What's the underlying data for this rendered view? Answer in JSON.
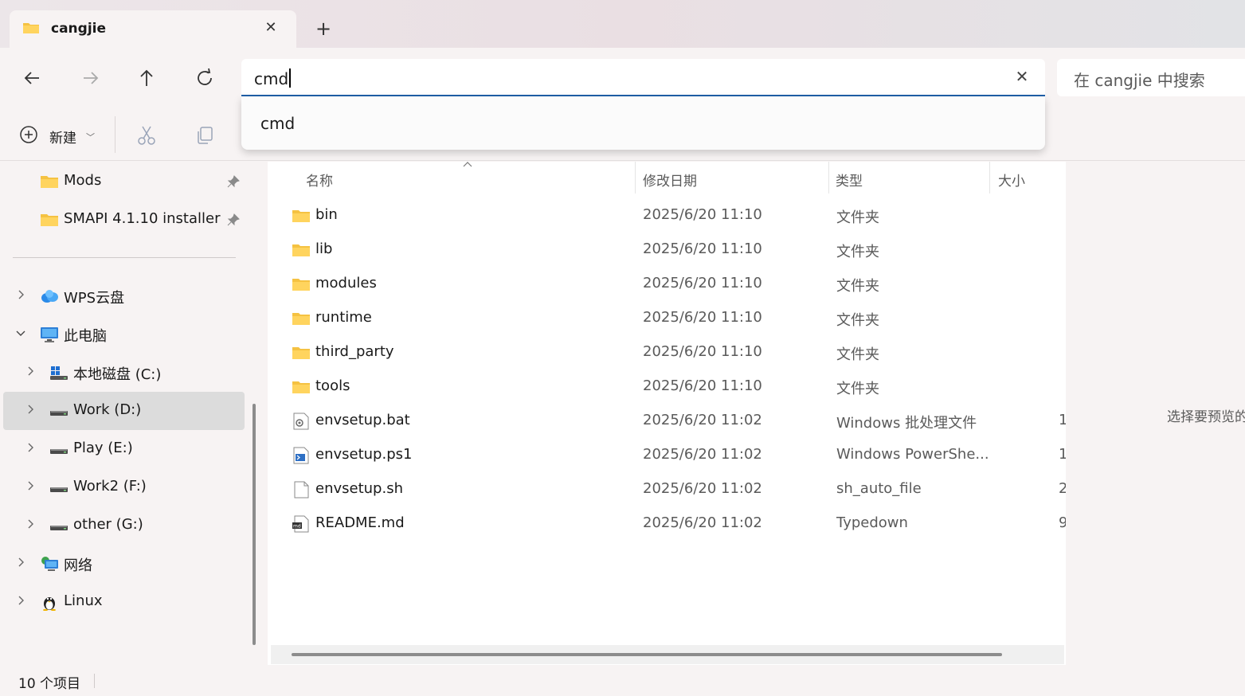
{
  "tab": {
    "title": "cangjie",
    "close_icon": "close-icon",
    "new_tab_icon": "plus-icon"
  },
  "nav": {
    "back_icon": "arrow-left-icon",
    "forward_icon": "arrow-right-icon",
    "up_icon": "arrow-up-icon",
    "refresh_icon": "refresh-icon",
    "address_value": "cmd",
    "search_placeholder": "在 cangjie 中搜索"
  },
  "suggestions": [
    "cmd"
  ],
  "toolbar": {
    "new_label": "新建"
  },
  "sidebar": {
    "pinned": [
      {
        "label": "Mods"
      },
      {
        "label": "SMAPI 4.1.10 installer"
      }
    ],
    "tree": [
      {
        "label": "WPS云盘",
        "icon": "cloud-icon",
        "expanded": false
      },
      {
        "label": "此电脑",
        "icon": "computer-icon",
        "expanded": true
      },
      {
        "label": "本地磁盘 (C:)",
        "icon": "windows-drive-icon",
        "expanded": false
      },
      {
        "label": "Work (D:)",
        "icon": "drive-icon",
        "expanded": false,
        "selected": true
      },
      {
        "label": "Play (E:)",
        "icon": "drive-icon",
        "expanded": false
      },
      {
        "label": "Work2 (F:)",
        "icon": "drive-icon",
        "expanded": false
      },
      {
        "label": "other (G:)",
        "icon": "drive-icon",
        "expanded": false
      },
      {
        "label": "网络",
        "icon": "network-icon",
        "expanded": false
      },
      {
        "label": "Linux",
        "icon": "linux-icon",
        "expanded": false
      }
    ]
  },
  "columns": {
    "name": "名称",
    "modified": "修改日期",
    "type": "类型",
    "size": "大小"
  },
  "files": [
    {
      "name": "bin",
      "date": "2025/6/20 11:10",
      "type": "文件夹",
      "size": "",
      "icon": "folder-icon"
    },
    {
      "name": "lib",
      "date": "2025/6/20 11:10",
      "type": "文件夹",
      "size": "",
      "icon": "folder-icon"
    },
    {
      "name": "modules",
      "date": "2025/6/20 11:10",
      "type": "文件夹",
      "size": "",
      "icon": "folder-icon"
    },
    {
      "name": "runtime",
      "date": "2025/6/20 11:10",
      "type": "文件夹",
      "size": "",
      "icon": "folder-icon"
    },
    {
      "name": "third_party",
      "date": "2025/6/20 11:10",
      "type": "文件夹",
      "size": "",
      "icon": "folder-icon"
    },
    {
      "name": "tools",
      "date": "2025/6/20 11:10",
      "type": "文件夹",
      "size": "",
      "icon": "folder-icon"
    },
    {
      "name": "envsetup.bat",
      "date": "2025/6/20 11:02",
      "type": "Windows 批处理文件",
      "size": "1",
      "icon": "batch-file-icon"
    },
    {
      "name": "envsetup.ps1",
      "date": "2025/6/20 11:02",
      "type": "Windows PowerShe...",
      "size": "1",
      "icon": "powershell-file-icon"
    },
    {
      "name": "envsetup.sh",
      "date": "2025/6/20 11:02",
      "type": "sh_auto_file",
      "size": "2",
      "icon": "file-icon"
    },
    {
      "name": "README.md",
      "date": "2025/6/20 11:02",
      "type": "Typedown",
      "size": "9",
      "icon": "markdown-file-icon"
    }
  ],
  "preview": {
    "text": "选择要预览的"
  },
  "status": {
    "item_count": "10 个项目"
  },
  "colors": {
    "accent": "#1f5fa8",
    "folder": "#f5c242",
    "selected": "#dcdcdc"
  }
}
